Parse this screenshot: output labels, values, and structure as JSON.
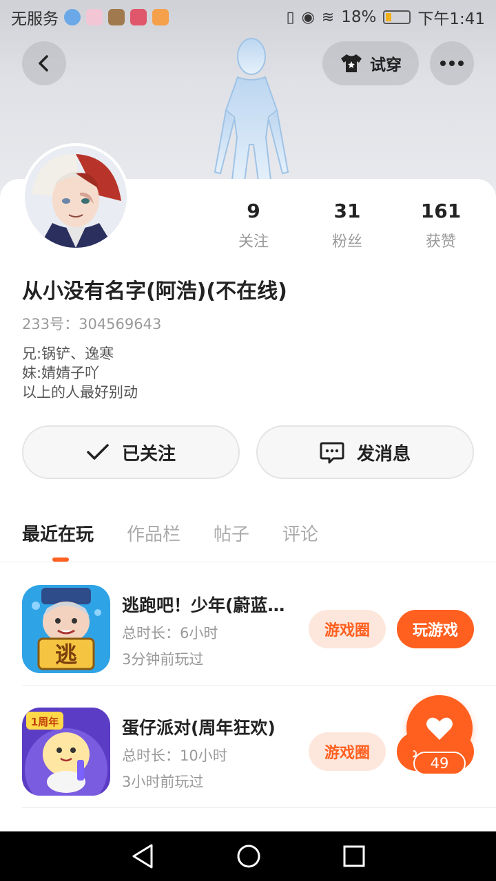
{
  "status_bar": {
    "carrier": "无服务",
    "battery": "18%",
    "time": "下午1:41"
  },
  "header": {
    "try_on_label": "试穿"
  },
  "profile": {
    "stats": [
      {
        "num": "9",
        "label": "关注"
      },
      {
        "num": "31",
        "label": "粉丝"
      },
      {
        "num": "161",
        "label": "获赞"
      }
    ],
    "name": "从小没有名字(阿浩)(不在线)",
    "uid_label": "233号：",
    "uid": "304569643",
    "bio_lines": [
      "兄:锅铲、逸寒",
      "妹:婧婧子吖",
      "以上的人最好别动"
    ],
    "follow_label": "已关注",
    "message_label": "发消息"
  },
  "tabs": [
    "最近在玩",
    "作品栏",
    "帖子",
    "评论"
  ],
  "games": [
    {
      "title": "逃跑吧！少年(蔚蓝…",
      "duration": "总时长：6小时",
      "last_played": "3分钟前玩过",
      "circle_label": "游戏圈",
      "play_label": "玩游戏",
      "icon_text": "逃"
    },
    {
      "title": "蛋仔派对(周年狂欢)",
      "duration": "总时长：10小时",
      "last_played": "3小时前玩过",
      "circle_label": "游戏圈",
      "play_label": "玩游戏",
      "icon_text": "1周年"
    }
  ],
  "like": {
    "count": "49"
  },
  "colors": {
    "accent": "#ff5f1f",
    "accent_light": "#fde7dc"
  }
}
